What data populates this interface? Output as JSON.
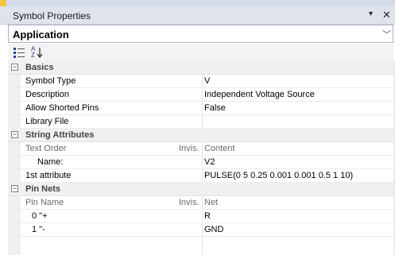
{
  "panel": {
    "title": "Symbol Properties",
    "pin_glyph": "▾",
    "close_glyph": "✕"
  },
  "combo": {
    "value": "Application",
    "chevron": "﹀"
  },
  "toolbar": {
    "categorized_icon": "categorized-icon",
    "alphabetical_icon": "sort-alphabetical-icon",
    "alpha_top": "A",
    "alpha_bottom": "Z"
  },
  "categories": {
    "basics": "Basics",
    "string_attributes": "String Attributes",
    "pin_nets": "Pin Nets"
  },
  "basics": [
    {
      "name": "Symbol Type",
      "value": "V"
    },
    {
      "name": "Description",
      "value": "Independent Voltage Source"
    },
    {
      "name": "Allow Shorted Pins",
      "value": "False"
    },
    {
      "name": "Library File",
      "value": ""
    }
  ],
  "string_attributes": {
    "header": {
      "name": "Text Order",
      "invis": "Invis.",
      "value": "Content"
    },
    "rows": [
      {
        "name": "Name:",
        "value": "V2"
      },
      {
        "name": "1st attribute",
        "value": "PULSE(0 5 0.25 0.001 0.001 0.5 1 10)"
      }
    ]
  },
  "pin_nets": {
    "header": {
      "name": "Pin Name",
      "invis": "Invis.",
      "value": "Net"
    },
    "rows": [
      {
        "name": "0 \"+",
        "value": "R"
      },
      {
        "name": "1 \"-",
        "value": "GND"
      }
    ]
  },
  "colors": {
    "titlebar": "#dfe3ec",
    "category_bg": "#f0f0f0",
    "border": "#a8b3c8"
  }
}
